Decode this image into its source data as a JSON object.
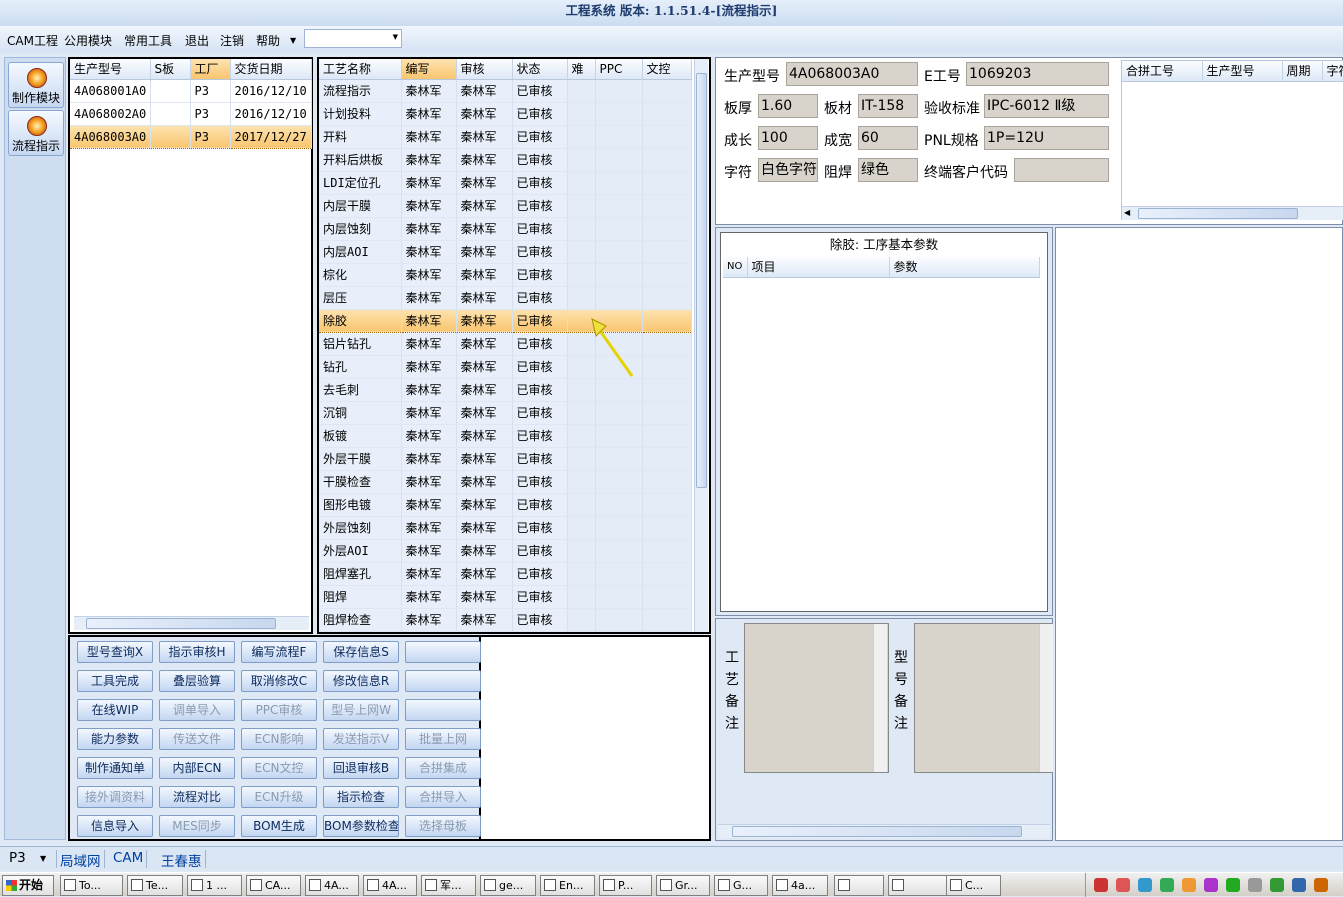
{
  "title": "工程系统 版本: 1.1.51.4-[流程指示]",
  "menu": [
    "CAM工程",
    "公用模块",
    "常用工具",
    "退出",
    "注销",
    "帮助"
  ],
  "nav": [
    "制作模块",
    "流程指示"
  ],
  "orders": {
    "headers": [
      "生产型号",
      "S板",
      "工厂",
      "交货日期"
    ],
    "rows": [
      [
        "4A068001A0",
        "",
        "P3",
        "2016/12/10"
      ],
      [
        "4A068002A0",
        "",
        "P3",
        "2016/12/10"
      ],
      [
        "4A068003A0",
        "",
        "P3",
        "2017/12/27"
      ]
    ],
    "selected": 2
  },
  "process": {
    "headers": [
      "工艺名称",
      "编写",
      "审核",
      "状态",
      "难",
      "PPC",
      "文控"
    ],
    "rows": [
      [
        "流程指示",
        "秦林军",
        "秦林军",
        "已审核"
      ],
      [
        "计划投料",
        "秦林军",
        "秦林军",
        "已审核"
      ],
      [
        "开料",
        "秦林军",
        "秦林军",
        "已审核"
      ],
      [
        "开料后烘板",
        "秦林军",
        "秦林军",
        "已审核"
      ],
      [
        "LDI定位孔",
        "秦林军",
        "秦林军",
        "已审核"
      ],
      [
        "内层干膜",
        "秦林军",
        "秦林军",
        "已审核"
      ],
      [
        "内层蚀刻",
        "秦林军",
        "秦林军",
        "已审核"
      ],
      [
        "内层AOI",
        "秦林军",
        "秦林军",
        "已审核"
      ],
      [
        "棕化",
        "秦林军",
        "秦林军",
        "已审核"
      ],
      [
        "层压",
        "秦林军",
        "秦林军",
        "已审核"
      ],
      [
        "除胶",
        "秦林军",
        "秦林军",
        "已审核"
      ],
      [
        "铝片钻孔",
        "秦林军",
        "秦林军",
        "已审核"
      ],
      [
        "钻孔",
        "秦林军",
        "秦林军",
        "已审核"
      ],
      [
        "去毛刺",
        "秦林军",
        "秦林军",
        "已审核"
      ],
      [
        "沉铜",
        "秦林军",
        "秦林军",
        "已审核"
      ],
      [
        "板镀",
        "秦林军",
        "秦林军",
        "已审核"
      ],
      [
        "外层干膜",
        "秦林军",
        "秦林军",
        "已审核"
      ],
      [
        "干膜检查",
        "秦林军",
        "秦林军",
        "已审核"
      ],
      [
        "图形电镀",
        "秦林军",
        "秦林军",
        "已审核"
      ],
      [
        "外层蚀刻",
        "秦林军",
        "秦林军",
        "已审核"
      ],
      [
        "外层AOI",
        "秦林军",
        "秦林军",
        "已审核"
      ],
      [
        "阻焊塞孔",
        "秦林军",
        "秦林军",
        "已审核"
      ],
      [
        "阻焊",
        "秦林军",
        "秦林军",
        "已审核"
      ],
      [
        "阻焊检查",
        "秦林军",
        "秦林军",
        "已审核"
      ]
    ],
    "selected": 10
  },
  "buttons": [
    [
      {
        "t": "型号查询X",
        "e": true
      },
      {
        "t": "指示审核H",
        "e": true
      },
      {
        "t": "编写流程F",
        "e": true
      },
      {
        "t": "保存信息S",
        "e": true
      },
      {
        "t": "",
        "e": true
      }
    ],
    [
      {
        "t": "工具完成",
        "e": true
      },
      {
        "t": "叠层验算",
        "e": true
      },
      {
        "t": "取消修改C",
        "e": true
      },
      {
        "t": "修改信息R",
        "e": true
      },
      {
        "t": "",
        "e": true
      }
    ],
    [
      {
        "t": "在线WIP",
        "e": true
      },
      {
        "t": "调单导入",
        "e": false
      },
      {
        "t": "PPC审核",
        "e": false
      },
      {
        "t": "型号上网W",
        "e": false
      },
      {
        "t": "",
        "e": true
      }
    ],
    [
      {
        "t": "能力参数",
        "e": true
      },
      {
        "t": "传送文件",
        "e": false
      },
      {
        "t": "ECN影响",
        "e": false
      },
      {
        "t": "发送指示V",
        "e": false
      },
      {
        "t": "批量上网",
        "e": false
      }
    ],
    [
      {
        "t": "制作通知单",
        "e": true
      },
      {
        "t": "内部ECN",
        "e": true
      },
      {
        "t": "ECN文控",
        "e": false
      },
      {
        "t": "回退审核B",
        "e": true
      },
      {
        "t": "合拼集成",
        "e": false
      }
    ],
    [
      {
        "t": "接外调资料",
        "e": false
      },
      {
        "t": "流程对比",
        "e": true
      },
      {
        "t": "ECN升级",
        "e": false
      },
      {
        "t": "指示检查",
        "e": true
      },
      {
        "t": "合拼导入",
        "e": false
      }
    ],
    [
      {
        "t": "信息导入",
        "e": true
      },
      {
        "t": "MES同步",
        "e": false
      },
      {
        "t": "BOM生成",
        "e": true
      },
      {
        "t": "BOM参数检查",
        "e": true
      },
      {
        "t": "选择母板",
        "e": false
      }
    ]
  ],
  "info": {
    "model_label": "生产型号",
    "model": "4A068003A0",
    "eno_label": "E工号",
    "eno": "1069203",
    "thick_label": "板厚",
    "thick": "1.60",
    "material_label": "板材",
    "material": "IT-158",
    "std_label": "验收标准",
    "std": "IPC-6012 Ⅱ级",
    "len_label": "成长",
    "len": "100",
    "wid_label": "成宽",
    "wid": "60",
    "pnl_label": "PNL规格",
    "pnl": "1P=12U",
    "char_label": "字符",
    "char": "白色字符",
    "mask_label": "阻焊",
    "mask": "绿色",
    "cust_label": "终端客户代码",
    "cust": ""
  },
  "merge": {
    "headers": [
      "合拼工号",
      "生产型号",
      "周期",
      "字符"
    ]
  },
  "params": {
    "title": "除胶: 工序基本参数",
    "headers": [
      "NO",
      "项目",
      "参数"
    ]
  },
  "notes": {
    "process": [
      "工",
      "艺",
      "备",
      "注"
    ],
    "model": [
      "型",
      "号",
      "备",
      "注"
    ]
  },
  "status": {
    "factory": "P3",
    "tabs": [
      "局域网",
      "CAM",
      "王春惠"
    ]
  },
  "taskbar": {
    "start": "开始",
    "items": [
      "To...",
      "Te...",
      "1 ...",
      "CA...",
      "4A...",
      "4A...",
      "军...",
      "ge...",
      "En...",
      "P...",
      "Gr...",
      "G...",
      "4a...",
      "",
      "",
      "C..."
    ]
  },
  "colors": {
    "selection": "#f9c570",
    "arrow": "#f2e03a",
    "accent": "#0040a0"
  }
}
